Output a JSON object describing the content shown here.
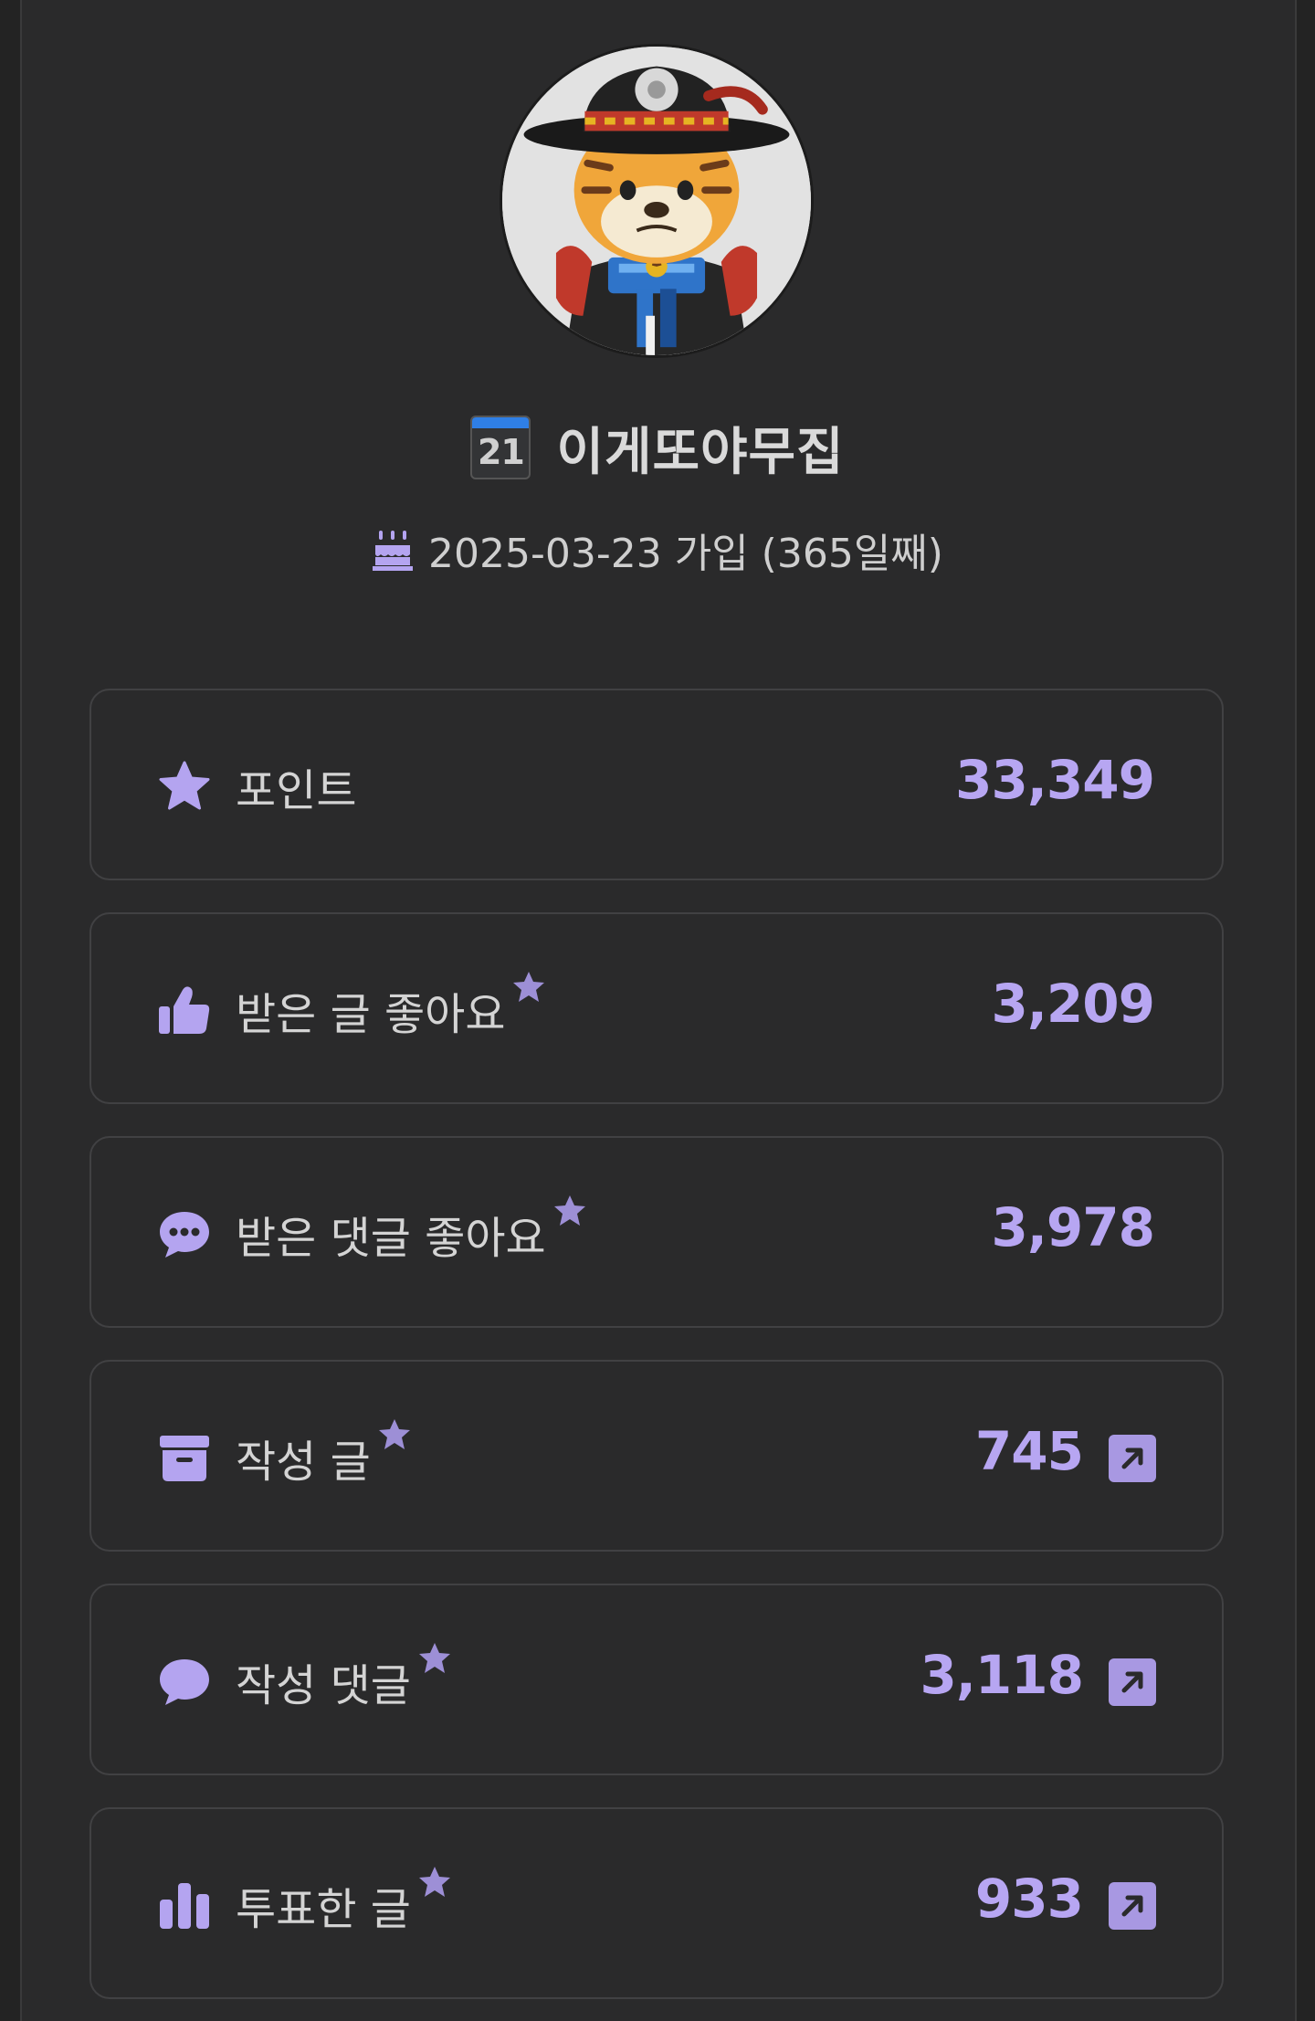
{
  "profile": {
    "name": "이게또야무집",
    "calendar_day": "21",
    "join_text": "2025-03-23 가입 (365일째)"
  },
  "colors": {
    "accent": "#b7a6f2",
    "icon": "#b4a4f0",
    "star_badge": "#9d8fd6",
    "panel_bg": "#2a2a2b"
  },
  "stats": [
    {
      "label": "포인트",
      "value": "33,349",
      "icon": "star-icon",
      "badge": false,
      "link": false
    },
    {
      "label": "받은 글 좋아요",
      "value": "3,209",
      "icon": "thumbs-up-icon",
      "badge": true,
      "link": false
    },
    {
      "label": "받은 댓글 좋아요",
      "value": "3,978",
      "icon": "comment-dots-icon",
      "badge": true,
      "link": false
    },
    {
      "label": "작성 글",
      "value": "745",
      "icon": "archive-box-icon",
      "badge": true,
      "link": true
    },
    {
      "label": "작성 댓글",
      "value": "3,118",
      "icon": "comment-icon",
      "badge": true,
      "link": true
    },
    {
      "label": "투표한 글",
      "value": "933",
      "icon": "bar-chart-icon",
      "badge": true,
      "link": true
    }
  ]
}
